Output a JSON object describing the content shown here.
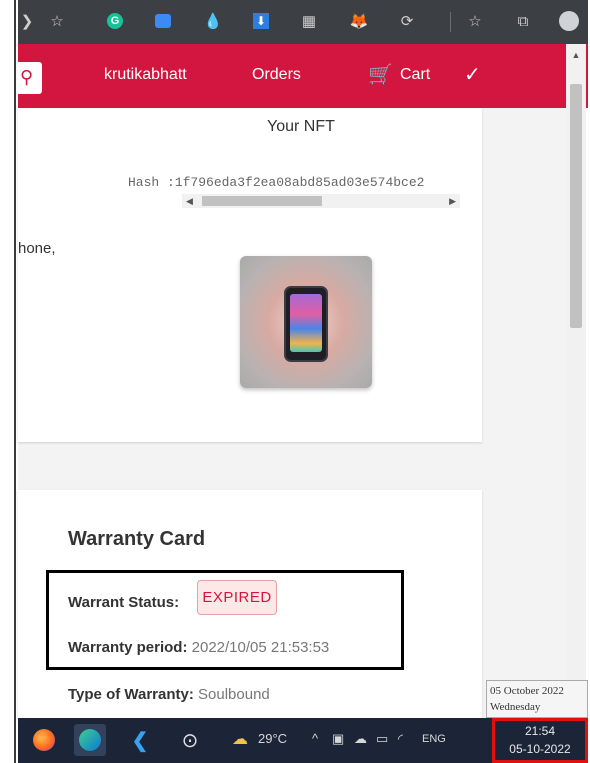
{
  "navbar": {
    "user_link": "krutikabhatt",
    "orders_link": "Orders",
    "cart_link": "Cart"
  },
  "nft_card": {
    "title": "Your NFT",
    "hash_label": "Hash :",
    "hash_value": "1f796eda3f2ea08abd85ad03e574bce2",
    "description_fragment": "hone,"
  },
  "warranty": {
    "title": "Warranty Card",
    "status_label": "Warrant Status:",
    "status_value": "EXPIRED",
    "period_label": "Warranty period:",
    "period_value": "2022/10/05 21:53:53",
    "type_label": "Type of Warranty:",
    "type_value": "Soulbound"
  },
  "tooltip": {
    "date_line": "05 October 2022",
    "day_line": "Wednesday"
  },
  "taskbar": {
    "temperature": "29°C",
    "language": "ENG",
    "time": "21:54",
    "date": "05-10-2022"
  },
  "colors": {
    "brand": "#d2163f",
    "toolbar": "#3c3f44",
    "taskbar": "#1b2537",
    "expired_text": "#d2163f"
  },
  "icons": [
    "search-icon",
    "cart-icon",
    "check-add-icon",
    "firefox-icon",
    "edge-icon",
    "vscode-icon",
    "weather-icon"
  ]
}
